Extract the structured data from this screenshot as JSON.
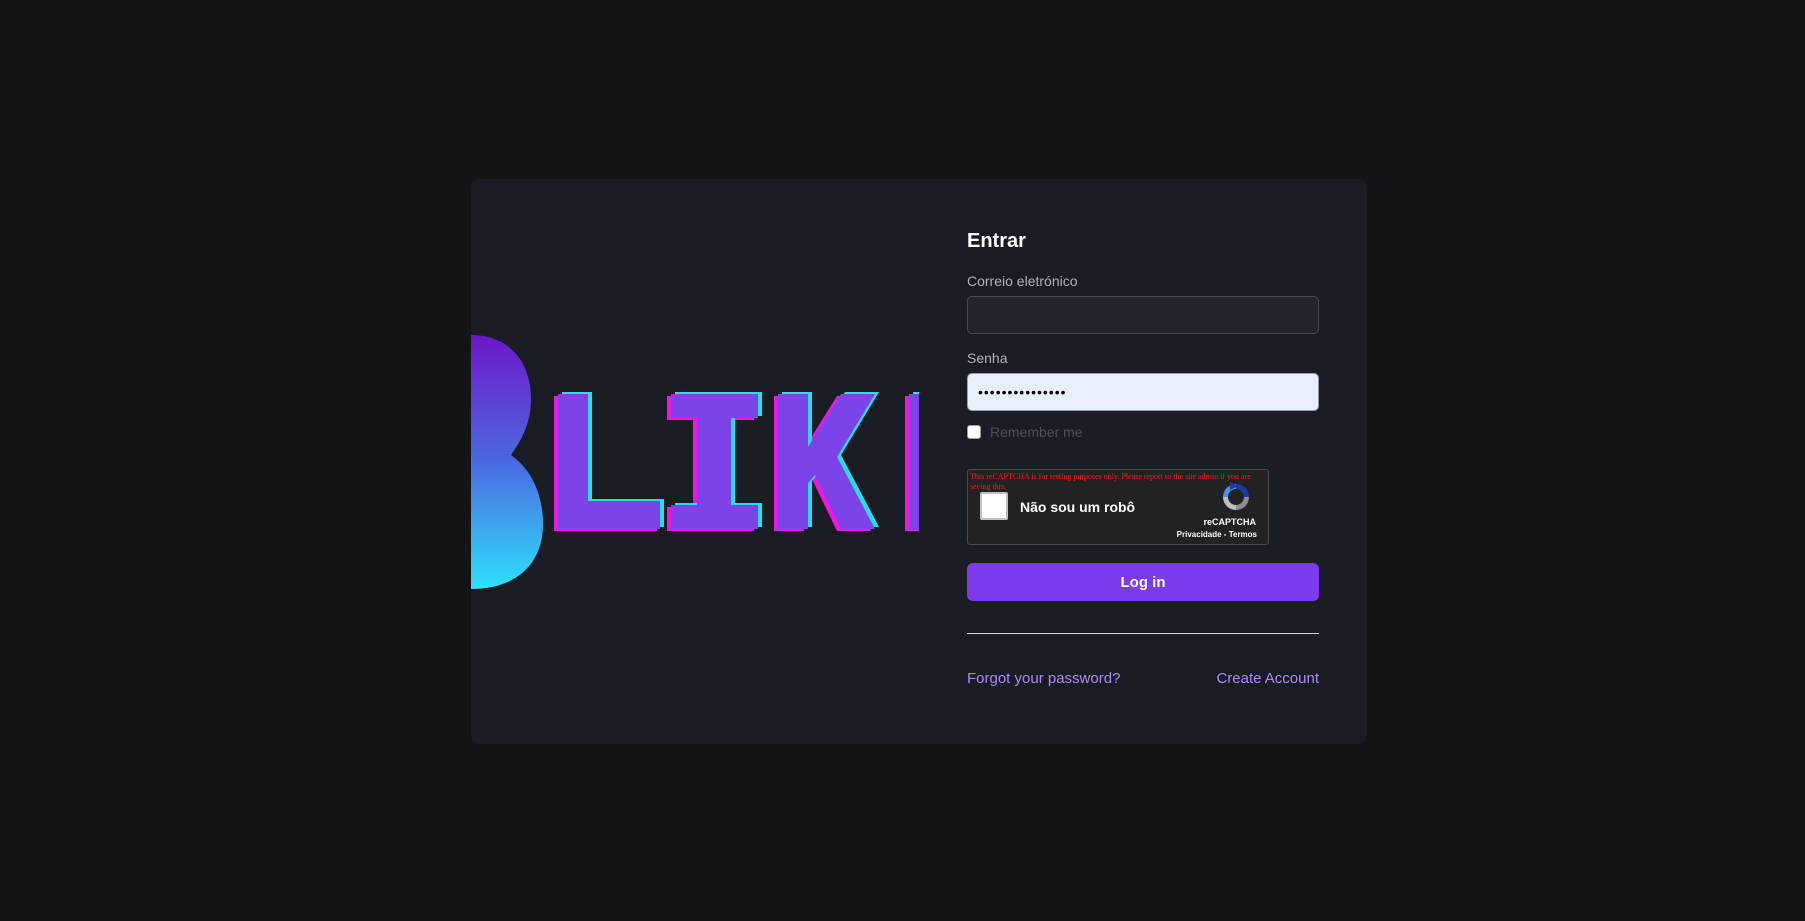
{
  "logo": {
    "visible_text": "BLIKI",
    "icon": "bliki-logo"
  },
  "form": {
    "title": "Entrar",
    "email": {
      "label": "Correio eletrónico",
      "value": "",
      "placeholder": ""
    },
    "password": {
      "label": "Senha",
      "masked_value": "•••••••••••••••"
    },
    "remember_me": {
      "label": "Remember me",
      "checked": false
    },
    "recaptcha": {
      "warning": "This reCAPTCHA is for testing purposes only. Please report to the site admin if you are seeing this.",
      "checkbox_label": "Não sou um robô",
      "brand": "reCAPTCHA",
      "terms": "Privacidade - Termos",
      "icon": "recaptcha-icon"
    },
    "submit_label": "Log in",
    "forgot_password": "Forgot your password?",
    "create_account": "Create Account"
  },
  "colors": {
    "page_bg": "#131418",
    "card_bg": "#1a1c23",
    "accent": "#7c3aed",
    "link": "#a78bfa"
  }
}
